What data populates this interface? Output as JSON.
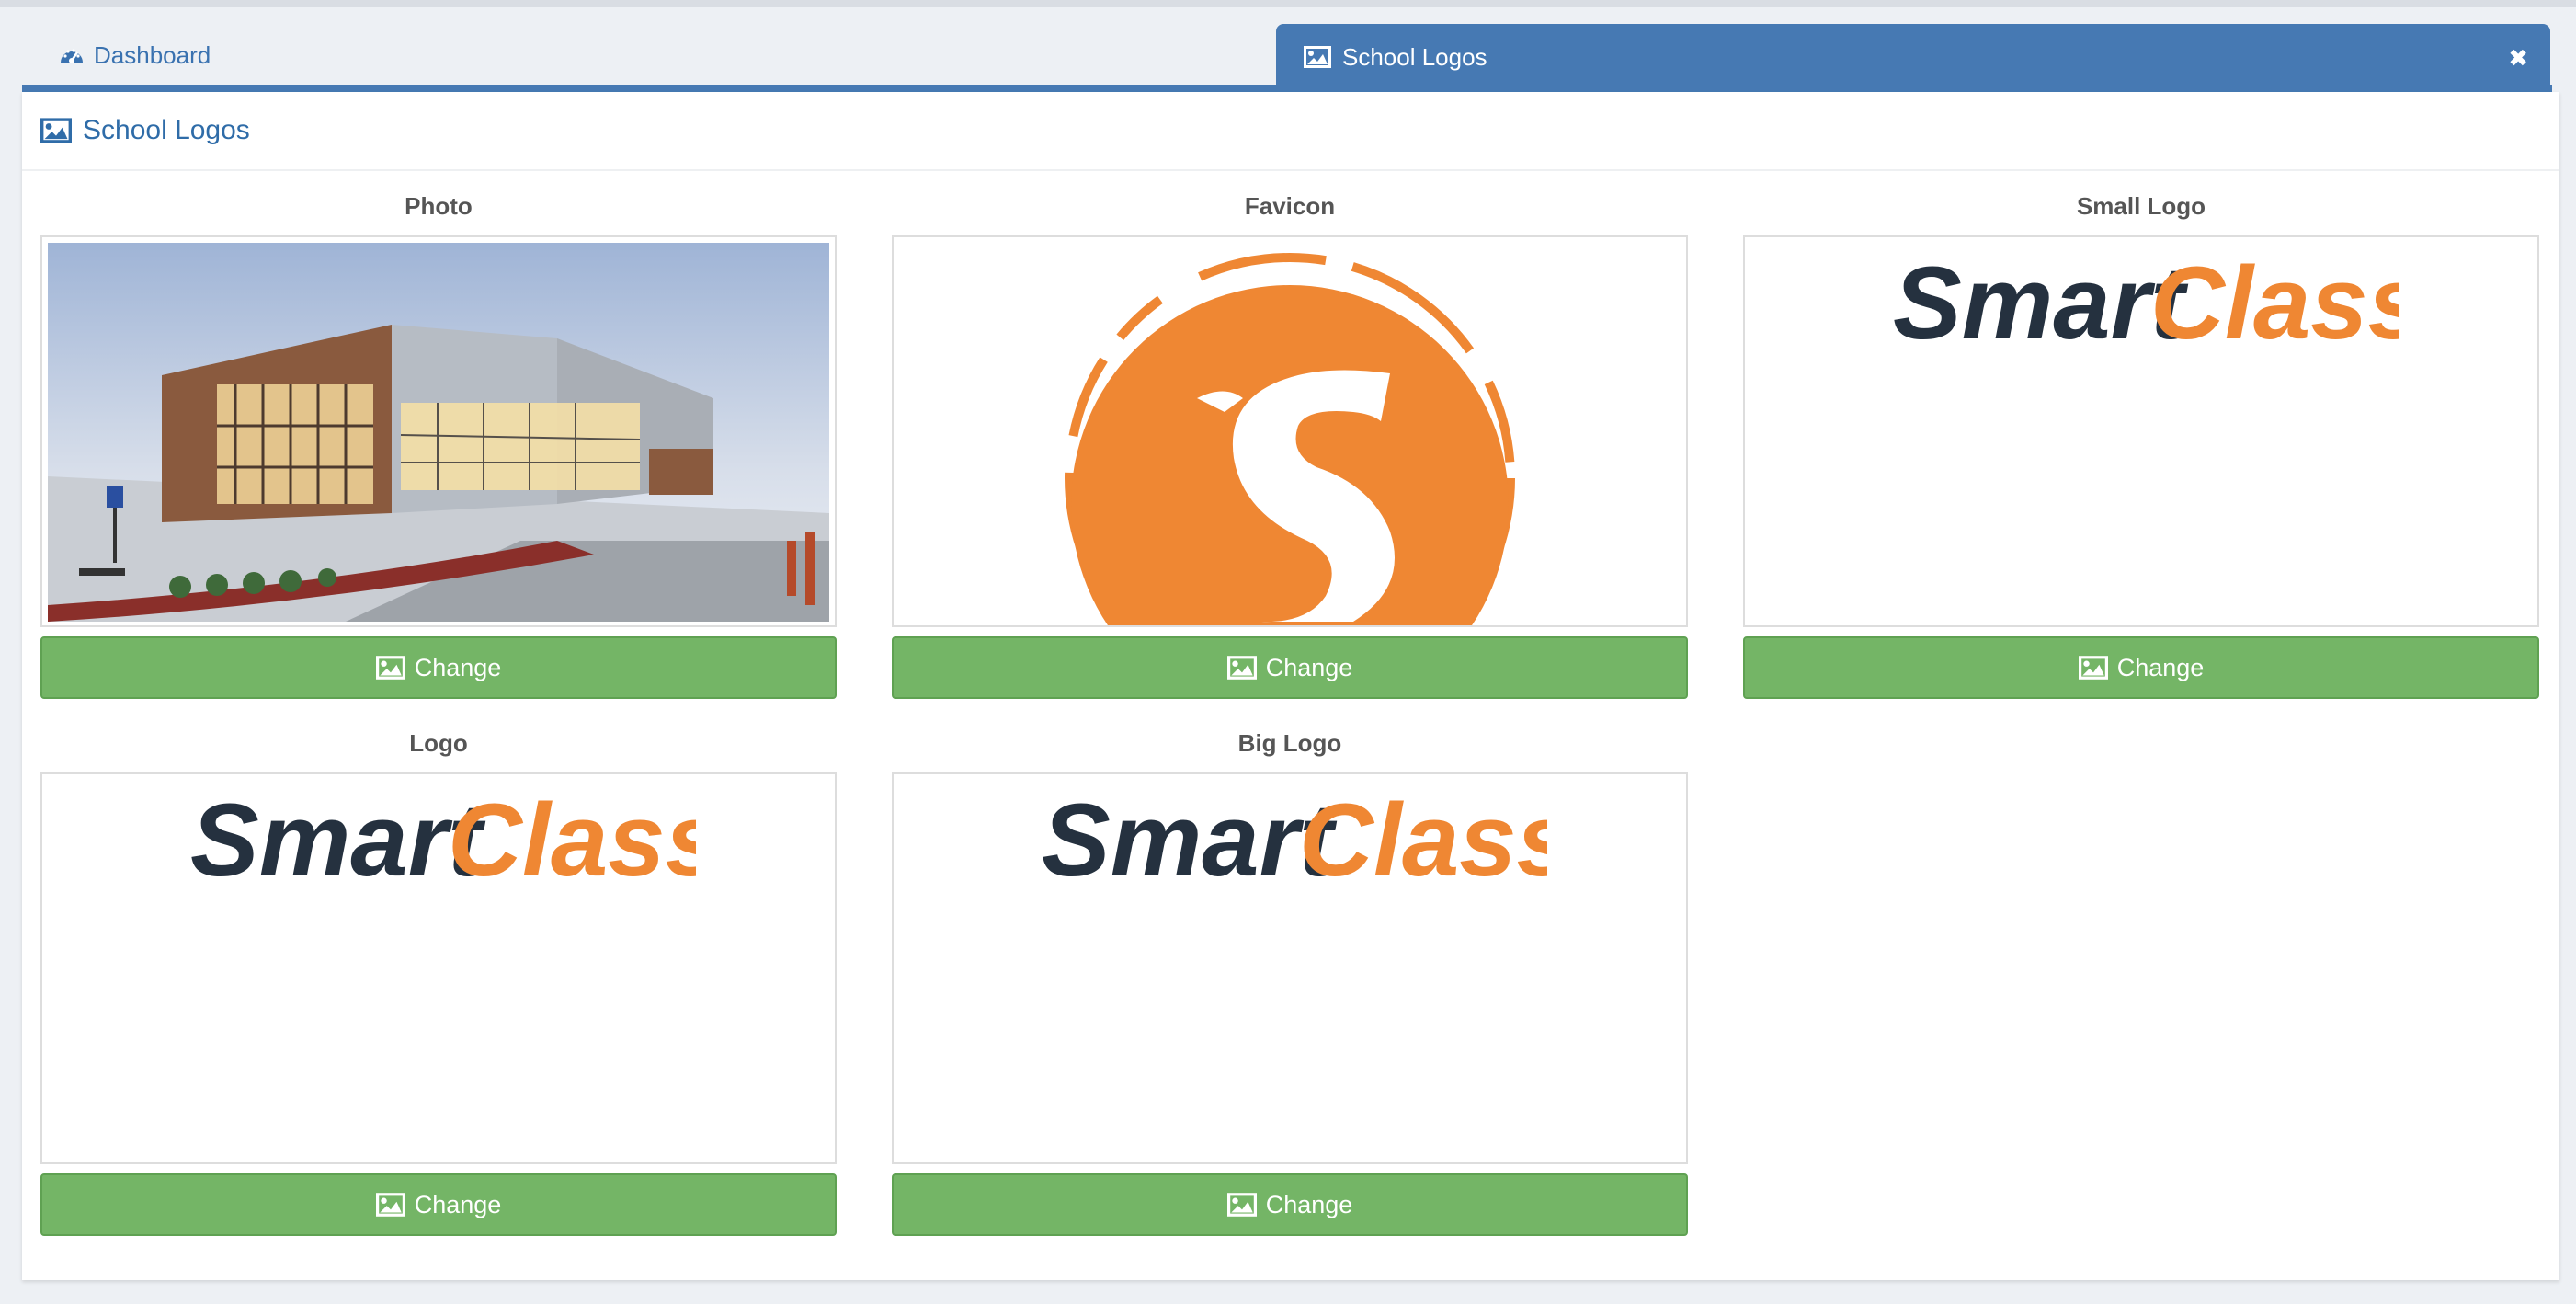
{
  "tabs": {
    "dashboard_label": "Dashboard",
    "active_label": "School Logos",
    "close_glyph": "✖"
  },
  "panel": {
    "title": "School Logos"
  },
  "cards": [
    {
      "title": "Photo",
      "button_label": "Change",
      "image": "school-building-photo"
    },
    {
      "title": "Favicon",
      "button_label": "Change",
      "image": "smartclass-favicon"
    },
    {
      "title": "Small Logo",
      "button_label": "Change",
      "image": "smartclass-logo"
    },
    {
      "title": "Logo",
      "button_label": "Change",
      "image": "smartclass-logo"
    },
    {
      "title": "Big Logo",
      "button_label": "Change",
      "image": "smartclass-logo"
    }
  ],
  "brand": {
    "logo_word_dark": "Smart",
    "logo_word_orange": "Class",
    "dark_color": "#25313f",
    "orange_color": "#ef8733",
    "accent_blue": "#4679b3",
    "button_green": "#74b566"
  },
  "icons": {
    "dashboard": "dashboard-icon",
    "image": "image-icon",
    "close": "close-icon"
  }
}
